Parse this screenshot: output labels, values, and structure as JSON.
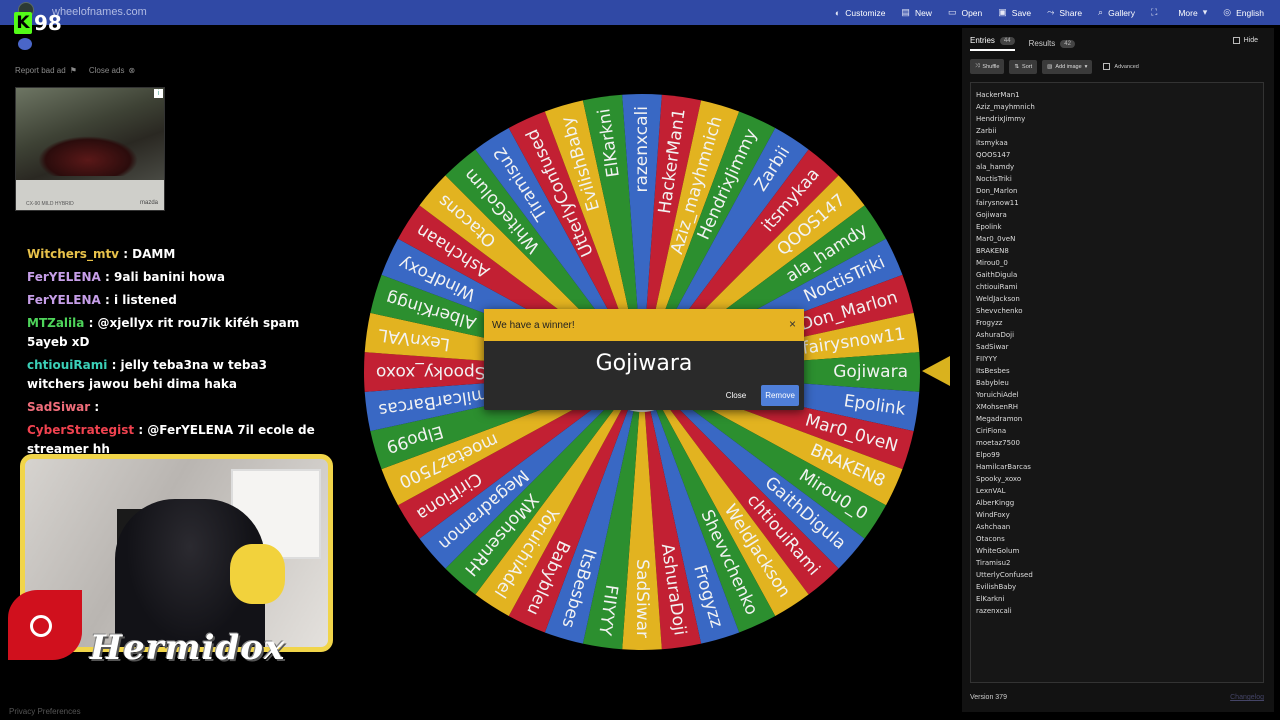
{
  "header": {
    "site": "wheelofnames.com",
    "nav": [
      {
        "icon": "palette-icon",
        "glyph": "◐",
        "label": "Customize"
      },
      {
        "icon": "file-icon",
        "glyph": "▤",
        "label": "New"
      },
      {
        "icon": "folder-icon",
        "glyph": "▭",
        "label": "Open"
      },
      {
        "icon": "save-icon",
        "glyph": "▣",
        "label": "Save"
      },
      {
        "icon": "share-icon",
        "glyph": "⤳",
        "label": "Share"
      },
      {
        "icon": "search-icon",
        "glyph": "⌕",
        "label": "Gallery"
      },
      {
        "icon": "fullscreen-icon",
        "glyph": "⛶",
        "label": ""
      },
      {
        "icon": "chevron-down-icon",
        "glyph": "▾",
        "label": "More"
      },
      {
        "icon": "globe-icon",
        "glyph": "◎",
        "label": "English"
      }
    ]
  },
  "overlay": {
    "viewer_count": "98"
  },
  "ads": {
    "report": "Report bad ad",
    "close": "Close ads",
    "caption": "CX-90 MILD HYBRID",
    "brand": "mazda"
  },
  "chat": [
    {
      "user": "Witchers_mtv",
      "color": "#e8c24a",
      "text": ": DAMM"
    },
    {
      "user": "FerYELENA",
      "color": "#c69ee8",
      "text": ": 9ali banini howa"
    },
    {
      "user": "FerYELENA",
      "color": "#c69ee8",
      "text": ": i listened"
    },
    {
      "user": "MTZalila",
      "color": "#4ed45a",
      "text": ": @xjellyx rit rou7ik kiféh spam 5ayeb xD"
    },
    {
      "user": "chtiouiRami",
      "color": "#3bd0b8",
      "text": ": jelly teba3na w teba3 witchers jawou behi dima haka"
    },
    {
      "user": "SadSiwar",
      "color": "#ef6d7a",
      "text": ":"
    },
    {
      "user": "CyberStrategist",
      "color": "#f0424f",
      "text": ": @FerYELENA 7il ecole de streamer hh"
    }
  ],
  "streamer": {
    "name": "Hermidox"
  },
  "footer": {
    "privacy": "Privacy Preferences"
  },
  "wheel": {
    "entries": [
      "HackerMan1",
      "Aziz_mayhmnich",
      "HendrixJimmy",
      "Zarbii",
      "itsmykaa",
      "QOOS147",
      "ala_hamdy",
      "NoctisTriki",
      "Don_Marlon",
      "fairysnow11",
      "Gojiwara",
      "Epolink",
      "Mar0_0veN",
      "BRAKEN8",
      "Mirou0_0",
      "GaithDigula",
      "chtiouiRami",
      "WeldJackson",
      "Shevvchenko",
      "Frogyzz",
      "AshuraDoji",
      "SadSiwar",
      "FIIYYY",
      "ItsBesbes",
      "Babybleu",
      "YoruichiAdel",
      "XMohsenRH",
      "Megadramon",
      "CiriFiona",
      "moetaz7500",
      "Elpo99",
      "HamilcarBarcas",
      "Spooky_xoxo",
      "LexnVAL",
      "AlberKingg",
      "WindFoxy",
      "Ashchaan",
      "Otacons",
      "WhiteGolum",
      "Tiramisu2",
      "UtterlyConfused",
      "EvilishBaby",
      "ElKarkni",
      "razenxcali"
    ],
    "colors": [
      "#2c8f2f",
      "#3968c4",
      "#c22033",
      "#e2b320"
    ]
  },
  "dialog": {
    "title": "We have a winner!",
    "winner": "Gojiwara",
    "close": "Close",
    "remove": "Remove",
    "x": "×"
  },
  "panel": {
    "tab_entries": "Entries",
    "entries_count": "44",
    "tab_results": "Results",
    "results_count": "42",
    "hide": "Hide",
    "shuffle": "Shuffle",
    "sort": "Sort",
    "add_image": "Add image",
    "advanced": "Advanced",
    "version": "Version 379",
    "changelog": "Changelog"
  }
}
